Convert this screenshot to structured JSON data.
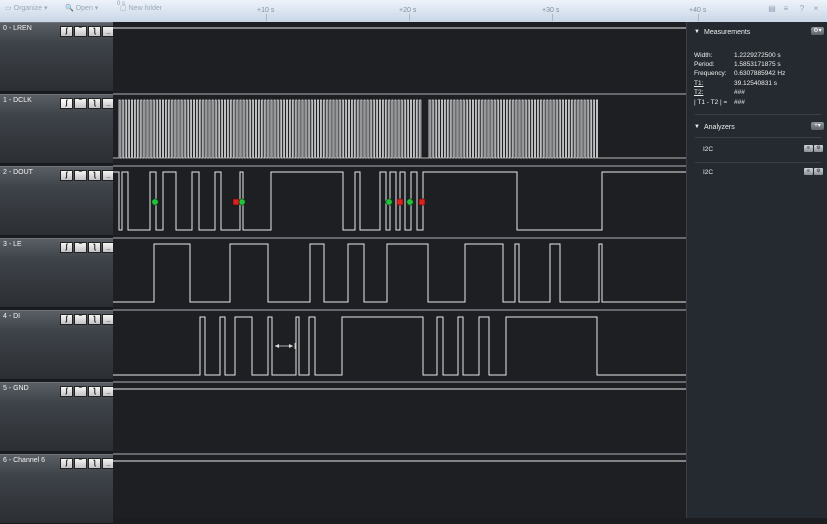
{
  "toolbar": {
    "items": [
      {
        "icon": "organize-icon",
        "label": "Organize ▾"
      },
      {
        "icon": "open-icon",
        "label": "Open ▾"
      },
      {
        "icon": "new-folder-icon",
        "label": "New folder"
      }
    ]
  },
  "timeline": {
    "origin_label": "0 s",
    "labels": [
      "+10 s",
      "+20 s",
      "+30 s",
      "+40 s"
    ]
  },
  "channels": [
    {
      "name": "0 - LREN"
    },
    {
      "name": "1 - DCLK"
    },
    {
      "name": "2 - DOUT"
    },
    {
      "name": "3 - LE"
    },
    {
      "name": "4 - DI"
    },
    {
      "name": "5 - GND"
    },
    {
      "name": "6 - Channel 6"
    }
  ],
  "trigger_buttons": [
    "ʃ",
    "‾",
    "ƪ",
    "_"
  ],
  "measurements": {
    "title": "Measurements",
    "rows": [
      {
        "key": "Width:",
        "value": "1.2229272500 s"
      },
      {
        "key": "Period:",
        "value": "1.5853171875 s"
      },
      {
        "key": "Frequency:",
        "value": "0.6307885942 Hz"
      },
      {
        "key": "T1:",
        "value": "39.12540831 s"
      },
      {
        "key": "T2:",
        "value": "###"
      },
      {
        "key": "| T1 - T2 | =",
        "value": "###"
      }
    ]
  },
  "analyzers": {
    "title": "Analyzers",
    "items": [
      {
        "name": "I2C"
      },
      {
        "name": "I2C"
      }
    ]
  },
  "colors": {
    "marker_green": "#22c33a",
    "marker_red": "#e02020",
    "signal": "#e8e8e8"
  }
}
